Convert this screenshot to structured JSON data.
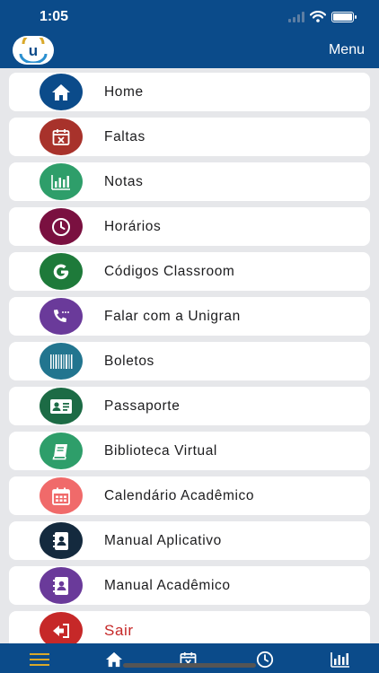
{
  "status_bar": {
    "time": "1:05"
  },
  "header": {
    "logo_text": "u",
    "menu_label": "Menu"
  },
  "menu": {
    "items": [
      {
        "label": "Home",
        "icon": "home-icon",
        "color": "#0b4b8a"
      },
      {
        "label": "Faltas",
        "icon": "calendar-x-icon",
        "color": "#a8322b"
      },
      {
        "label": "Notas",
        "icon": "bar-chart-icon",
        "color": "#2e9e6a"
      },
      {
        "label": "Horários",
        "icon": "clock-icon",
        "color": "#7a1040"
      },
      {
        "label": "Códigos Classroom",
        "icon": "google-icon",
        "color": "#1e7a3a"
      },
      {
        "label": "Falar com a Unigran",
        "icon": "phone-icon",
        "color": "#6a3a9a"
      },
      {
        "label": "Boletos",
        "icon": "barcode-icon",
        "color": "#22758f"
      },
      {
        "label": "Passaporte",
        "icon": "id-card-icon",
        "color": "#1c6b45"
      },
      {
        "label": "Biblioteca Virtual",
        "icon": "book-icon",
        "color": "#2e9e6a"
      },
      {
        "label": "Calendário Acadêmico",
        "icon": "calendar-icon",
        "color": "#f06a6a"
      },
      {
        "label": "Manual Aplicativo",
        "icon": "contact-book-icon",
        "color": "#142a3e"
      },
      {
        "label": "Manual Acadêmico",
        "icon": "contact-book-icon",
        "color": "#6a3a9a"
      },
      {
        "label": "Sair",
        "icon": "logout-icon",
        "color": "#c62828"
      }
    ]
  },
  "tabbar": {
    "accent": "#d9a92b",
    "tabs": [
      {
        "icon": "hamburger-icon"
      },
      {
        "icon": "home-icon"
      },
      {
        "icon": "calendar-x-icon"
      },
      {
        "icon": "clock-icon"
      },
      {
        "icon": "bar-chart-icon"
      }
    ]
  }
}
